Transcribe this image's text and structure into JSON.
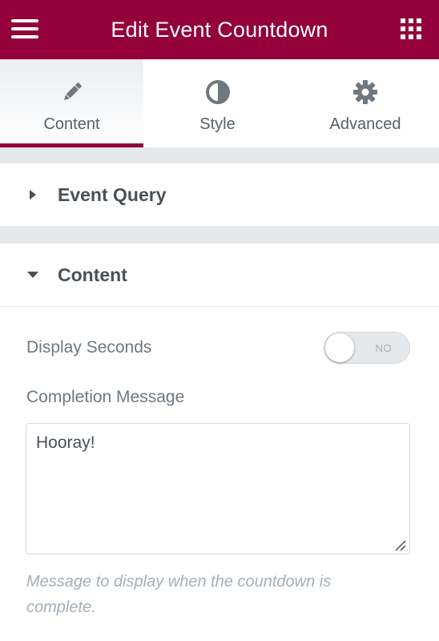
{
  "header": {
    "title": "Edit Event Countdown",
    "menu_icon": "hamburger-icon",
    "apps_icon": "grid-icon",
    "background": "#93003a"
  },
  "tabs": [
    {
      "label": "Content",
      "icon": "pencil-icon",
      "active": true
    },
    {
      "label": "Style",
      "icon": "half-circle-icon",
      "active": false
    },
    {
      "label": "Advanced",
      "icon": "gear-icon",
      "active": false
    }
  ],
  "sections": {
    "event_query": {
      "title": "Event Query",
      "expanded": false,
      "icon": "caret-right-icon"
    },
    "content": {
      "title": "Content",
      "expanded": true,
      "icon": "caret-down-icon"
    }
  },
  "controls": {
    "display_seconds": {
      "label": "Display Seconds",
      "toggle_text": "NO",
      "value": false
    },
    "completion_message": {
      "label": "Completion Message",
      "value": "Hooray!",
      "description": "Message to display when the countdown is complete."
    }
  },
  "colors": {
    "accent": "#93003a",
    "panel_gap": "#e6e9ec",
    "text": "#495157",
    "muted": "#a4afb7"
  }
}
